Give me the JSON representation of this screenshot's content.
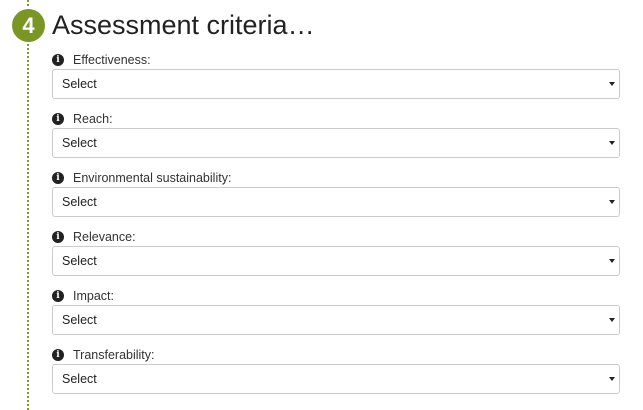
{
  "step": {
    "number": "4",
    "title": "Assessment criteria…"
  },
  "fields": [
    {
      "label": "Effectiveness:",
      "value": "Select"
    },
    {
      "label": "Reach:",
      "value": "Select"
    },
    {
      "label": "Environmental sustainability:",
      "value": "Select"
    },
    {
      "label": "Relevance:",
      "value": "Select"
    },
    {
      "label": "Impact:",
      "value": "Select"
    },
    {
      "label": "Transferability:",
      "value": "Select"
    }
  ],
  "icons": {
    "info": "info-circle-icon",
    "caret": "caret-down-icon"
  },
  "colors": {
    "step_accent": "#7a9625",
    "field_border": "#cccccc"
  }
}
